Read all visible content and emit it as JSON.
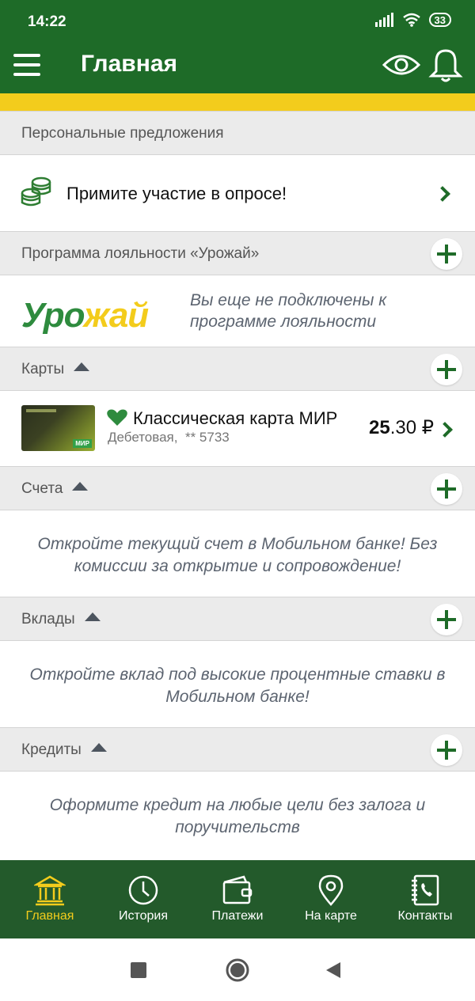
{
  "status": {
    "time": "14:22",
    "battery": "33"
  },
  "appbar": {
    "title": "Главная"
  },
  "colors": {
    "brand_green": "#1e6b28",
    "nav_green": "#235a2b",
    "accent_yellow": "#f3cc1c"
  },
  "offers": {
    "header": "Персональные предложения",
    "promo_text": "Примите участие в опросе!",
    "promo_icon": "coins-icon"
  },
  "loyalty": {
    "header": "Программа лояльности «Урожай»",
    "logo_text_a": "Уро",
    "logo_text_b": "жай",
    "message": "Вы еще не подключены к программе лояльности"
  },
  "cards": {
    "header": "Карты",
    "items": [
      {
        "name": "Классическая карта МИР",
        "type": "Дебетовая,",
        "mask": "** 5733",
        "balance_int": "25",
        "balance_frac": ".30 ₽",
        "brand": "МИР"
      }
    ]
  },
  "accounts": {
    "header": "Счета",
    "message": "Откройте текущий счет в Мобильном банке! Без комиссии за открытие и сопровождение!"
  },
  "deposits": {
    "header": "Вклады",
    "message": "Откройте вклад под высокие процентные ставки в Мобильном банке!"
  },
  "credits": {
    "header": "Кредиты",
    "message": "Оформите кредит на любые цели без залога и поручительств"
  },
  "bottom_nav": [
    {
      "label": "Главная",
      "icon": "bank-icon",
      "active": true
    },
    {
      "label": "История",
      "icon": "clock-icon",
      "active": false
    },
    {
      "label": "Платежи",
      "icon": "wallet-icon",
      "active": false
    },
    {
      "label": "На карте",
      "icon": "map-pin-icon",
      "active": false
    },
    {
      "label": "Контакты",
      "icon": "contacts-icon",
      "active": false
    }
  ]
}
